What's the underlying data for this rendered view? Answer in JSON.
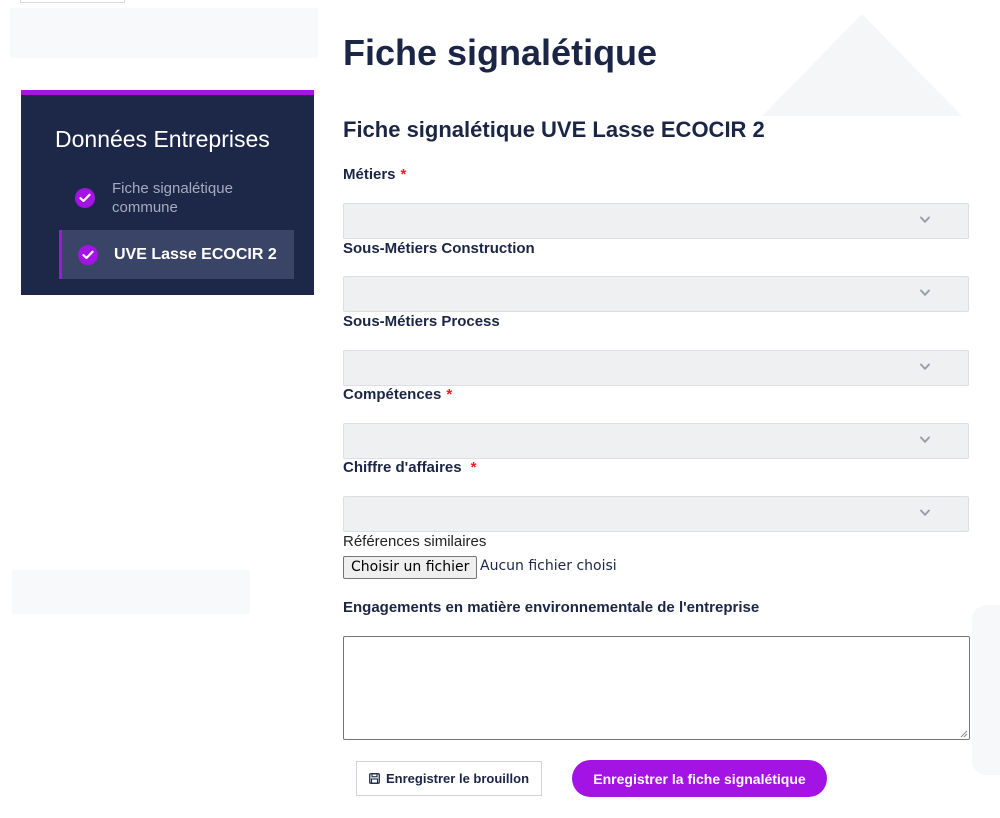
{
  "sidebar": {
    "title": "Données Entreprises",
    "items": [
      {
        "label_line1": "Fiche signalétique",
        "label_line2": "commune",
        "icon": "check-circle-icon"
      },
      {
        "label": "UVE Lasse ECOCIR 2",
        "icon": "check-circle-icon",
        "active": true
      }
    ]
  },
  "main": {
    "page_title": "Fiche signalétique",
    "form_title": "Fiche signalétique UVE Lasse ECOCIR 2",
    "fields": {
      "metiers": {
        "label": "Métiers",
        "required_mark": "*",
        "value": ""
      },
      "sous_metiers_construction": {
        "label": "Sous-Métiers Construction",
        "value": ""
      },
      "sous_metiers_process": {
        "label": "Sous-Métiers Process",
        "value": ""
      },
      "competences": {
        "label": "Compétences",
        "required_mark": "*",
        "value": ""
      },
      "chiffre_affaires": {
        "label": "Chiffre d'affaires",
        "required_mark": "*",
        "value": ""
      },
      "references": {
        "label": "Références similaires",
        "button": "Choisir un fichier",
        "status": "Aucun fichier choisi"
      },
      "engagements": {
        "label": "Engagements en matière environnementale de l'entreprise",
        "value": ""
      }
    },
    "buttons": {
      "draft": "Enregistrer le brouillon",
      "save": "Enregistrer la fiche signalétique"
    }
  },
  "colors": {
    "accent": "#a313e3",
    "navy": "#1d2849",
    "required": "#e0202a"
  }
}
